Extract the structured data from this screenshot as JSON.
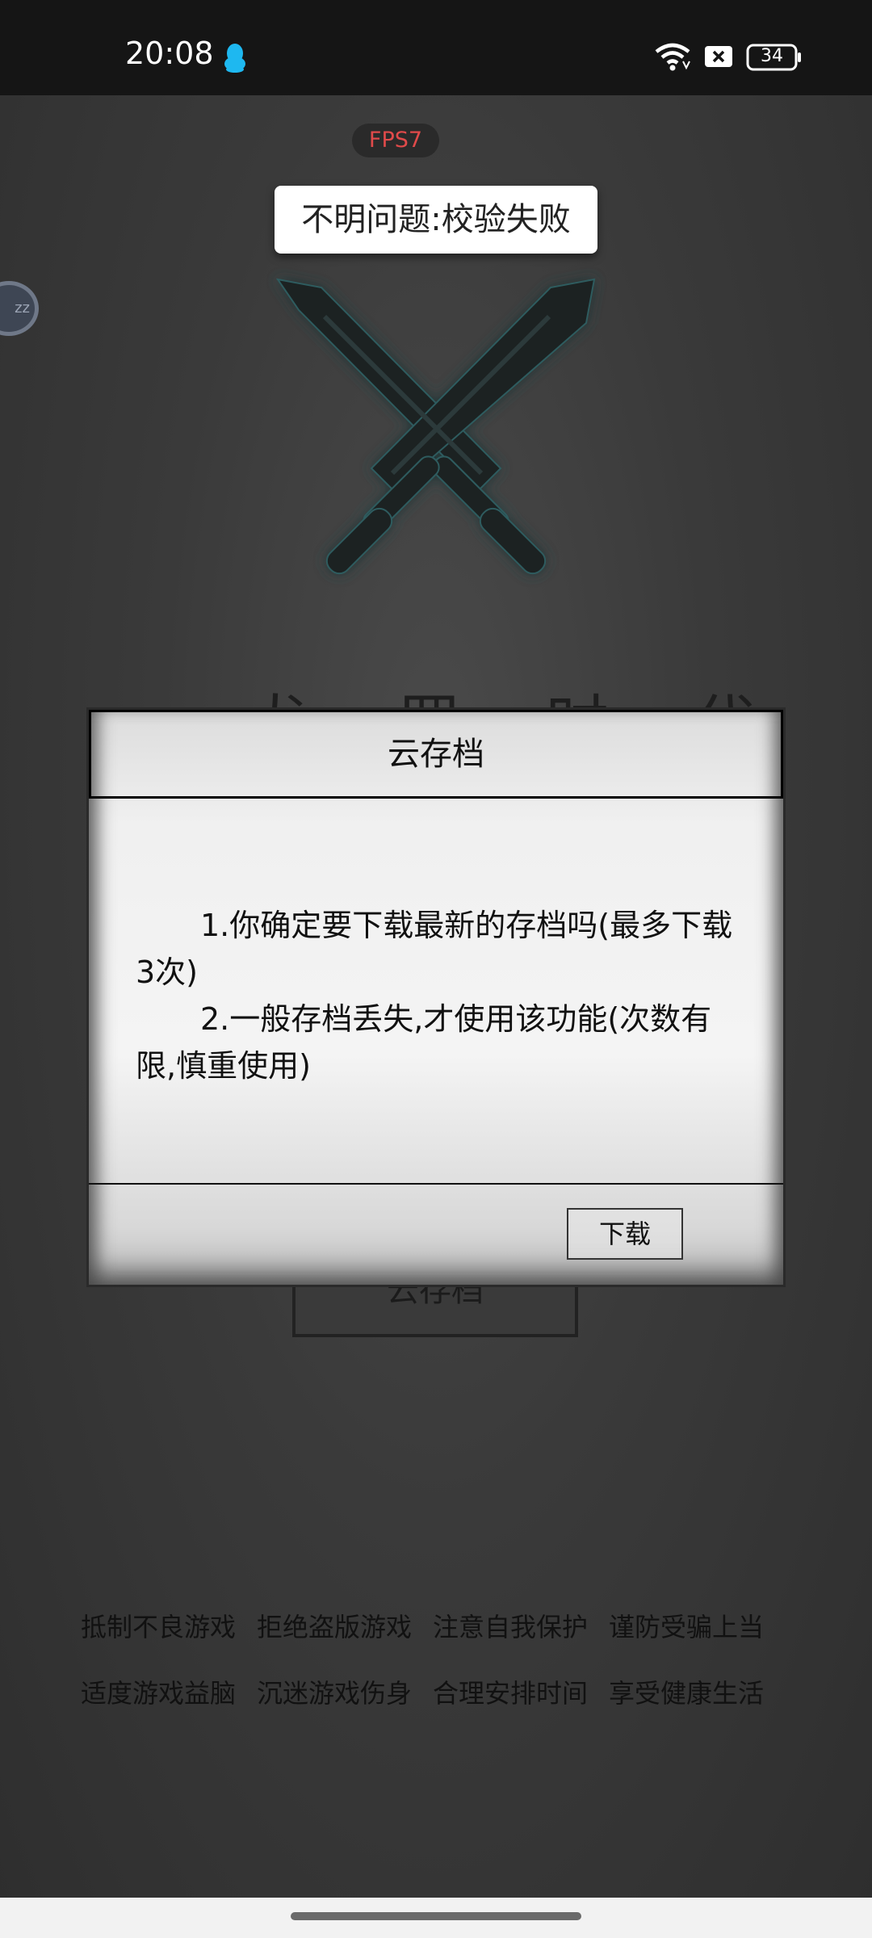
{
  "status_bar": {
    "time": "20:08",
    "battery": "34",
    "icons": [
      "qq-icon",
      "wifi-icon",
      "sim-off-icon",
      "battery-icon"
    ]
  },
  "fps": "FPS7",
  "toast": "不明问题:校验失败",
  "float_button_label": "zz",
  "background": {
    "title": "龙 罡 时 代",
    "cloud_button": "云存档"
  },
  "dialog": {
    "title": "云存档",
    "lines": [
      "1.你确定要下载最新的存档吗(最多下载3次)",
      "2.一般存档丢失,才使用该功能(次数有限,慎重使用)"
    ],
    "download_label": "下载"
  },
  "slogans": {
    "row1": [
      "抵制不良游戏",
      "拒绝盗版游戏",
      "注意自我保护",
      "谨防受骗上当"
    ],
    "row2": [
      "适度游戏益脑",
      "沉迷游戏伤身",
      "合理安排时间",
      "享受健康生活"
    ]
  },
  "colors": {
    "fps_text": "#e04a4a",
    "qq_blue": "#1eb8f0",
    "sword": "#1c2324"
  }
}
